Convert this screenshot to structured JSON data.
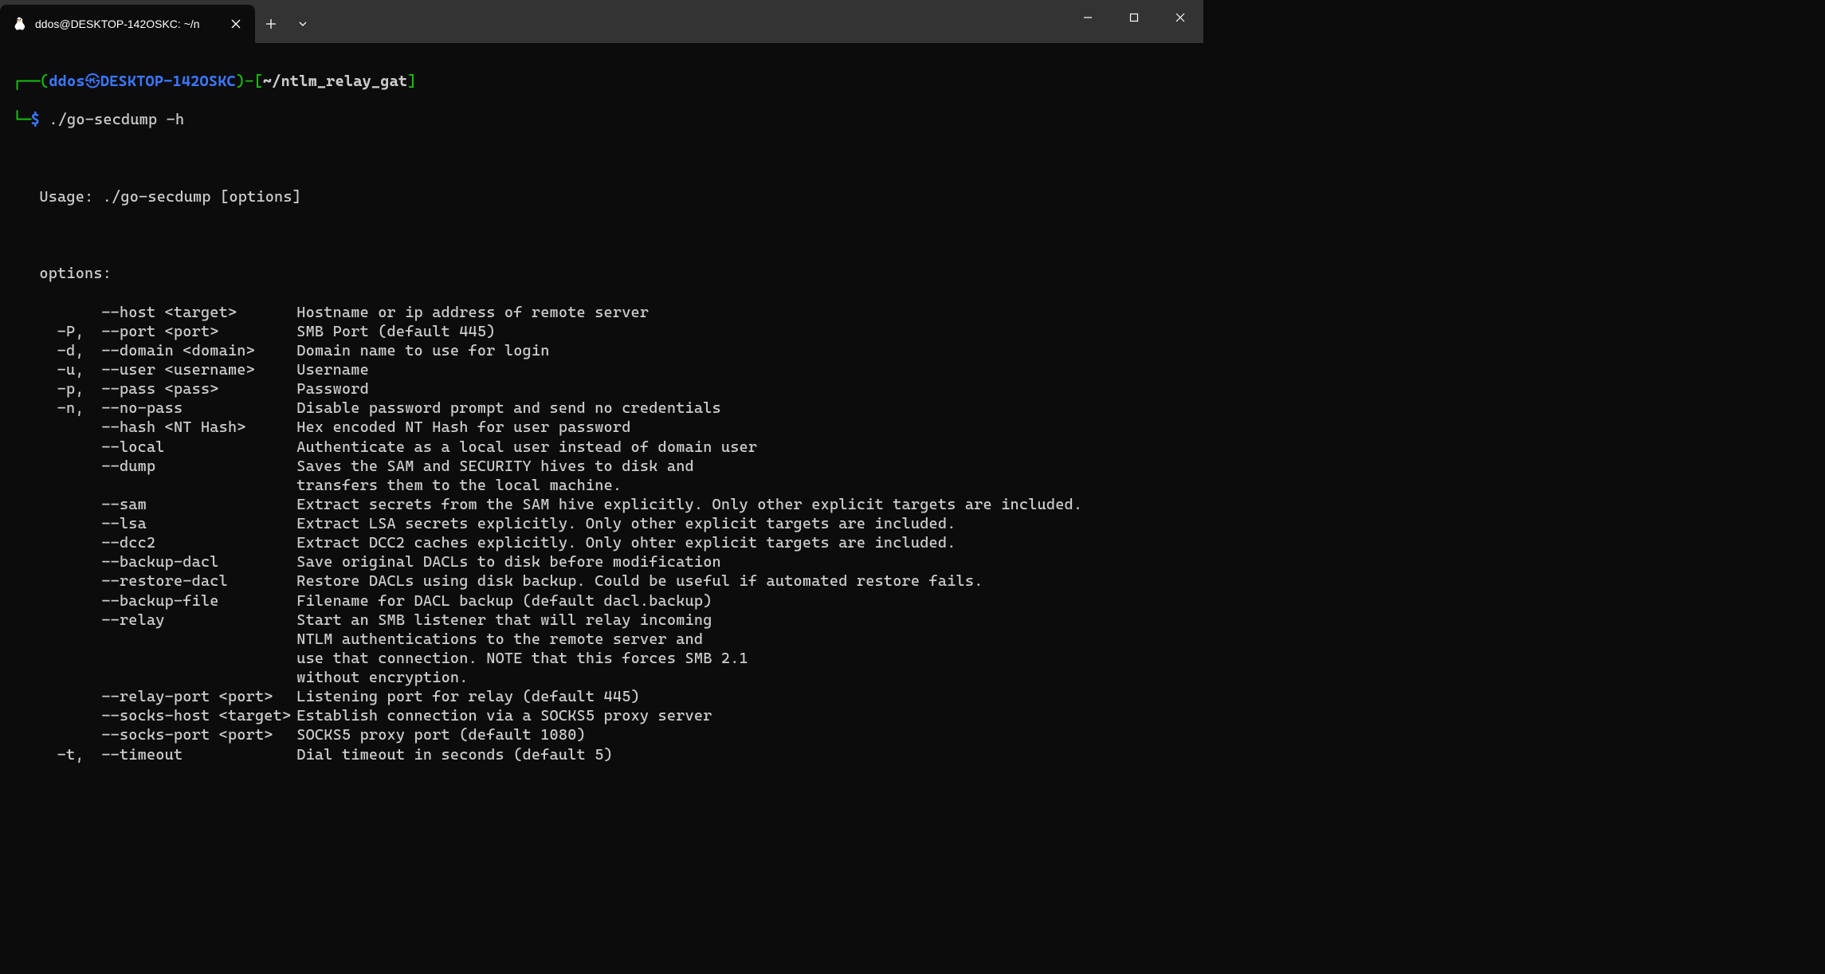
{
  "window": {
    "tab_title": "ddos@DESKTOP-142OSKC: ~/n"
  },
  "prompt": {
    "lparen": "(",
    "user": "ddos",
    "symbol": "㉿",
    "host": "DESKTOP-142OSKC",
    "rparen_dash": ")-",
    "lbracket": "[",
    "cwd": "~/ntlm_relay_gat",
    "rbracket": "]",
    "dollar": "$",
    "command": "./go-secdump -h"
  },
  "help": {
    "usage": "Usage: ./go-secdump [options]",
    "options_header": "options:",
    "rows": [
      {
        "short": "",
        "flag": "--host <target>",
        "desc": "Hostname or ip address of remote server"
      },
      {
        "short": "-P,",
        "flag": "--port <port>",
        "desc": "SMB Port (default 445)"
      },
      {
        "short": "-d,",
        "flag": "--domain <domain>",
        "desc": "Domain name to use for login"
      },
      {
        "short": "-u,",
        "flag": "--user <username>",
        "desc": "Username"
      },
      {
        "short": "-p,",
        "flag": "--pass <pass>",
        "desc": "Password"
      },
      {
        "short": "-n,",
        "flag": "--no-pass",
        "desc": "Disable password prompt and send no credentials"
      },
      {
        "short": "",
        "flag": "--hash <NT Hash>",
        "desc": "Hex encoded NT Hash for user password"
      },
      {
        "short": "",
        "flag": "--local",
        "desc": "Authenticate as a local user instead of domain user"
      },
      {
        "short": "",
        "flag": "--dump",
        "desc": "Saves the SAM and SECURITY hives to disk and"
      },
      {
        "cont": true,
        "desc": "transfers them to the local machine."
      },
      {
        "short": "",
        "flag": "--sam",
        "desc": "Extract secrets from the SAM hive explicitly. Only other explicit targets are included."
      },
      {
        "short": "",
        "flag": "--lsa",
        "desc": "Extract LSA secrets explicitly. Only other explicit targets are included."
      },
      {
        "short": "",
        "flag": "--dcc2",
        "desc": "Extract DCC2 caches explicitly. Only ohter explicit targets are included."
      },
      {
        "short": "",
        "flag": "--backup-dacl",
        "desc": "Save original DACLs to disk before modification"
      },
      {
        "short": "",
        "flag": "--restore-dacl",
        "desc": "Restore DACLs using disk backup. Could be useful if automated restore fails."
      },
      {
        "short": "",
        "flag": "--backup-file",
        "desc": "Filename for DACL backup (default dacl.backup)"
      },
      {
        "short": "",
        "flag": "--relay",
        "desc": "Start an SMB listener that will relay incoming"
      },
      {
        "cont": true,
        "desc": "NTLM authentications to the remote server and"
      },
      {
        "cont": true,
        "desc": "use that connection. NOTE that this forces SMB 2.1"
      },
      {
        "cont": true,
        "desc": "without encryption."
      },
      {
        "short": "",
        "flag": "--relay-port <port>",
        "desc": "Listening port for relay (default 445)"
      },
      {
        "short": "",
        "flag": "--socks-host <target>",
        "desc": "Establish connection via a SOCKS5 proxy server"
      },
      {
        "short": "",
        "flag": "--socks-port <port>",
        "desc": "SOCKS5 proxy port (default 1080)"
      },
      {
        "short": "-t,",
        "flag": "--timeout",
        "desc": "Dial timeout in seconds (default 5)"
      }
    ]
  }
}
